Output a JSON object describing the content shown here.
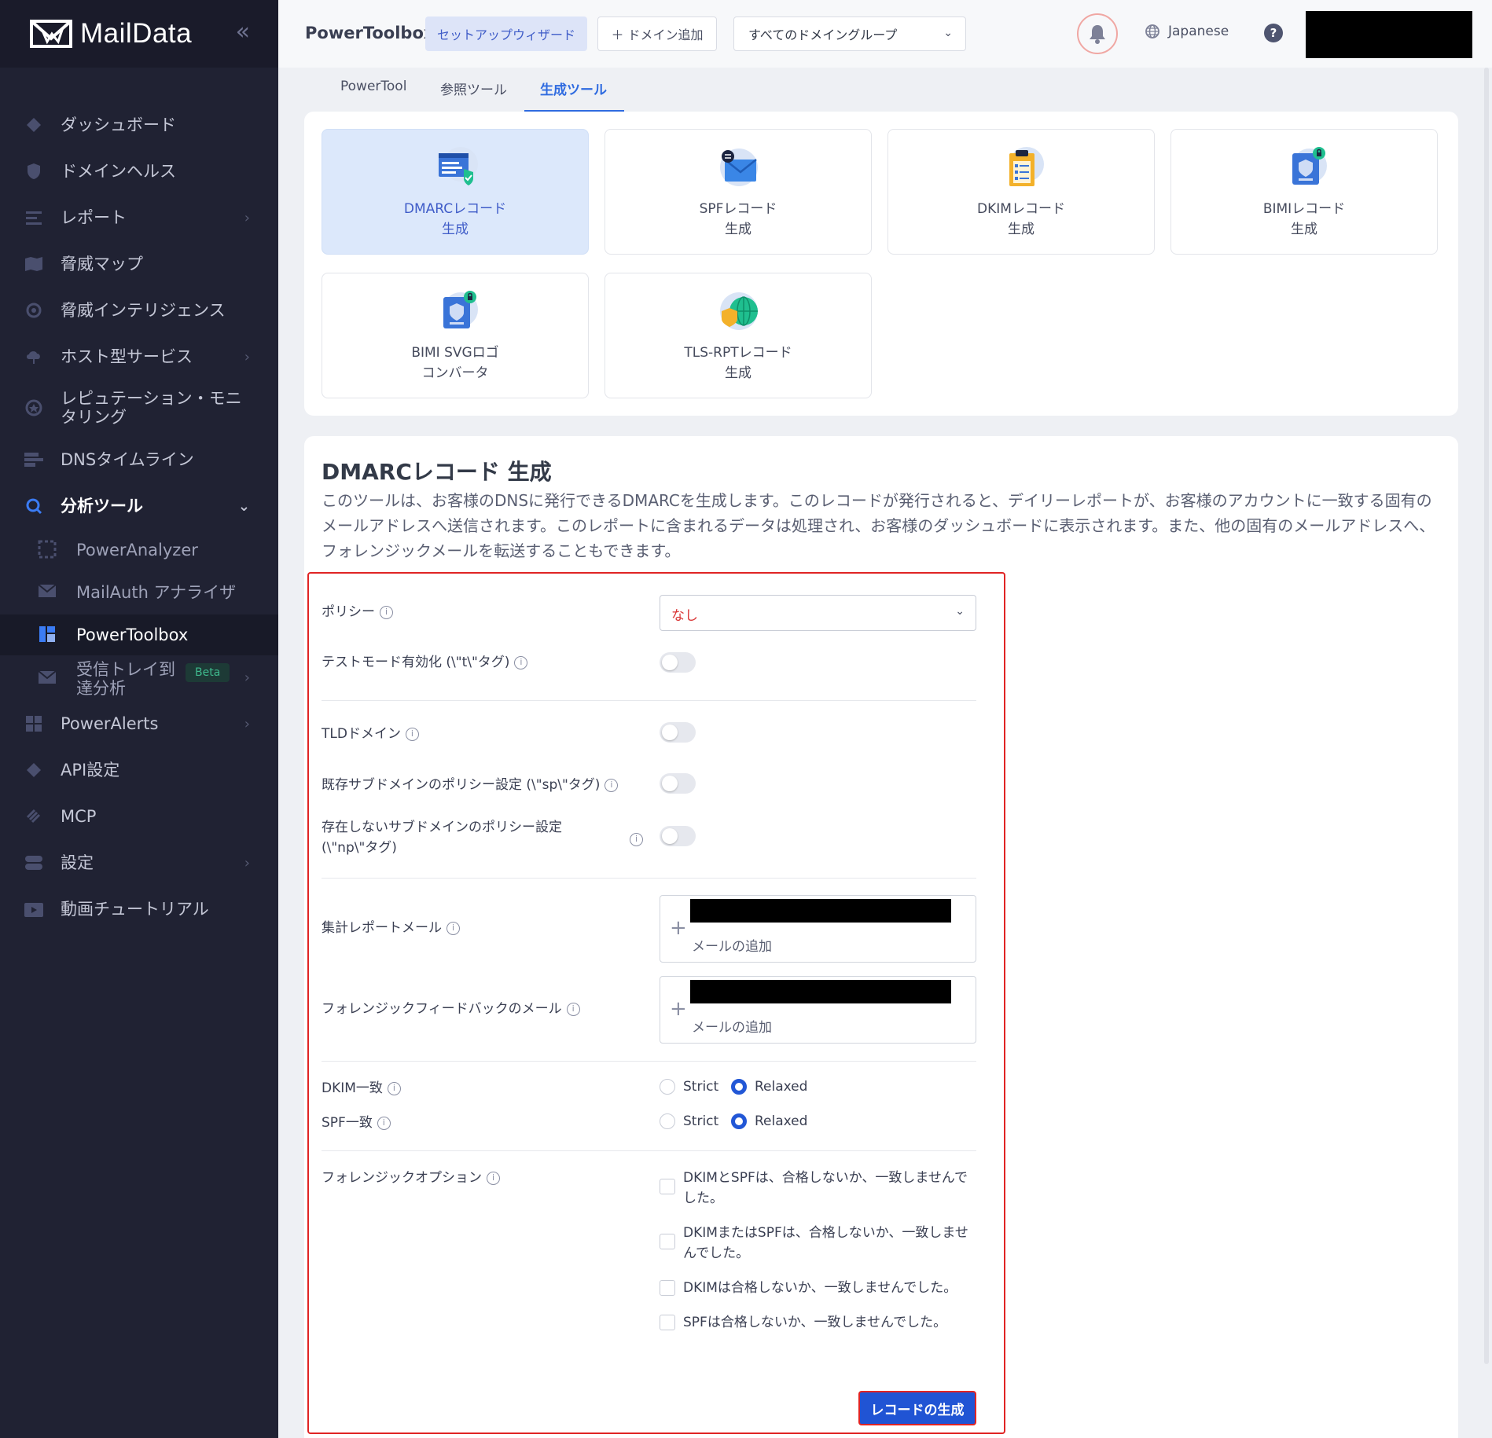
{
  "app": {
    "brand": "MailData",
    "collapse_icon": "double-chevron-left-icon"
  },
  "sidebar": {
    "items": [
      {
        "label": "ダッシュボード",
        "icon": "diamond-icon"
      },
      {
        "label": "ドメインヘルス",
        "icon": "shield-icon"
      },
      {
        "label": "レポート",
        "icon": "list-icon",
        "chevron": "›"
      },
      {
        "label": "脅威マップ",
        "icon": "map-icon"
      },
      {
        "label": "脅威インテリジェンス",
        "icon": "target-icon"
      },
      {
        "label": "ホスト型サービス",
        "icon": "cloud-icon",
        "chevron": "›"
      },
      {
        "label": "レピュテーション・モニタリング",
        "icon": "badge-icon"
      },
      {
        "label": "DNSタイムライン",
        "icon": "timeline-icon"
      },
      {
        "label": "分析ツール",
        "icon": "search-icon",
        "chevron": "⌄"
      },
      {
        "label": "PowerAlerts",
        "icon": "grid-icon",
        "chevron": "›"
      },
      {
        "label": "API設定",
        "icon": "diamond-icon"
      },
      {
        "label": "MCP",
        "icon": "mcp-icon"
      },
      {
        "label": "設定",
        "icon": "toggles-icon",
        "chevron": "›"
      },
      {
        "label": "動画チュートリアル",
        "icon": "video-icon"
      }
    ],
    "subitems": [
      {
        "label": "PowerAnalyzer",
        "icon": "dotted-square-icon"
      },
      {
        "label": "MailAuth アナライザ",
        "icon": "mail-check-icon"
      },
      {
        "label": "PowerToolbox",
        "icon": "toolbox-icon"
      },
      {
        "label": "受信トレイ到達分析",
        "icon": "mail-icon",
        "badge": "Beta",
        "chevron": "›"
      }
    ]
  },
  "topbar": {
    "title": "PowerToolbox",
    "wizard_label": "セットアップウィザード",
    "add_domain_label": "＋ ドメイン追加",
    "domain_group_value": "すべてのドメイングループ",
    "language": "Japanese",
    "help_label": "?"
  },
  "tabs": [
    "PowerTool",
    "参照ツール",
    "生成ツール"
  ],
  "tools": [
    {
      "name": "DMARCレコード",
      "sub": "生成",
      "icon": "dmarc-record-icon",
      "selected": true
    },
    {
      "name": "SPFレコード",
      "sub": "生成",
      "icon": "spf-envelope-icon"
    },
    {
      "name": "DKIMレコード",
      "sub": "生成",
      "icon": "dkim-clipboard-icon"
    },
    {
      "name": "BIMIレコード",
      "sub": "生成",
      "icon": "bimi-lock-icon"
    },
    {
      "name": "BIMI SVGロゴ",
      "sub": "コンバータ",
      "icon": "bimi-svg-icon"
    },
    {
      "name": "TLS-RPTレコード",
      "sub": "生成",
      "icon": "tls-globe-shield-icon"
    }
  ],
  "generator": {
    "title": "DMARCレコード 生成",
    "description": "このツールは、お客様のDNSに発行できるDMARCを生成します。このレコードが発行されると、デイリーレポートが、お客様のアカウントに一致する固有のメールアドレスへ送信されます。このレポートに含まれるデータは処理され、お客様のダッシュボードに表示されます。また、他の固有のメールアドレスへ、フォレンジックメールを転送することもできます。",
    "policy_label": "ポリシー",
    "policy_value": "なし",
    "testmode_label": "テストモード有効化 (\\\"t\\\"タグ)",
    "tld_label": "TLDドメイン",
    "sp_label": "既存サブドメインのポリシー設定 (\\\"sp\\\"タグ)",
    "np_label": "存在しないサブドメインのポリシー設定 (\\\"np\\\"タグ)",
    "aggregate_label": "集計レポートメール",
    "forensic_label": "フォレンジックフィードバックのメール",
    "add_email_label": "メールの追加",
    "dkim_align_label": "DKIM一致",
    "spf_align_label": "SPF一致",
    "strict_label": "Strict",
    "relaxed_label": "Relaxed",
    "forensic_options_label": "フォレンジックオプション",
    "forensic_options": [
      "DKIMとSPFは、合格しないか、一致しませんでした。",
      "DKIMまたはSPFは、合格しないか、一致しませんでした。",
      "DKIMは合格しないか、一致しませんでした。",
      "SPFは合格しないか、一致しませんでした。"
    ],
    "submit_label": "レコードの生成"
  },
  "colors": {
    "accent": "#2f6be0",
    "sidebar_bg": "#202233",
    "danger": "#e02424",
    "policy_value": "#d93434"
  }
}
